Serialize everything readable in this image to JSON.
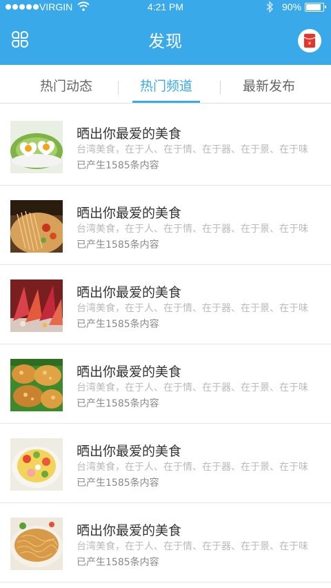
{
  "status_bar": {
    "carrier": "VIRGIN",
    "time": "4:21 PM",
    "battery": "90%",
    "battery_level": 0.9,
    "icons": [
      "signal-dots",
      "wifi-icon",
      "bluetooth-icon",
      "battery-icon"
    ]
  },
  "nav": {
    "title": "发现",
    "left_icon": "grid-menu-icon",
    "right_icon": "red-packet-icon"
  },
  "tabs": [
    {
      "label": "热门动态",
      "active": false
    },
    {
      "label": "热门频道",
      "active": true
    },
    {
      "label": "最新发布",
      "active": false
    }
  ],
  "colors": {
    "accent": "#3aa9ea",
    "red_packet": "#e8342b",
    "text_primary": "#333333",
    "text_muted": "#b9b9b9"
  },
  "channels": [
    {
      "title": "晒出你最爱的美食",
      "desc": "台湾美食，在于人、在于情、在于器、在于景、在于味",
      "count": "已产生1585条内容",
      "image": "eggs-lettuce-photo"
    },
    {
      "title": "晒出你最爱的美食",
      "desc": "台湾美食，在于人、在于情、在于器、在于景、在于味",
      "count": "已产生1585条内容",
      "image": "noodles-photo"
    },
    {
      "title": "晒出你最爱的美食",
      "desc": "台湾美食，在于人、在于情、在于器、在于景、在于味",
      "count": "已产生1585条内容",
      "image": "red-dish-photo"
    },
    {
      "title": "晒出你最爱的美食",
      "desc": "台湾美食，在于人、在于情、在于器、在于景、在于味",
      "count": "已产生1585条内容",
      "image": "fried-food-photo"
    },
    {
      "title": "晒出你最爱的美食",
      "desc": "台湾美食，在于人、在于情、在于器、在于景、在于味",
      "count": "已产生1585条内容",
      "image": "salad-bowl-photo"
    },
    {
      "title": "晒出你最爱的美食",
      "desc": "台湾美食，在于人、在于情、在于器、在于景、在于味",
      "count": "已产生1585条内容",
      "image": "crispy-noodles-photo"
    }
  ]
}
